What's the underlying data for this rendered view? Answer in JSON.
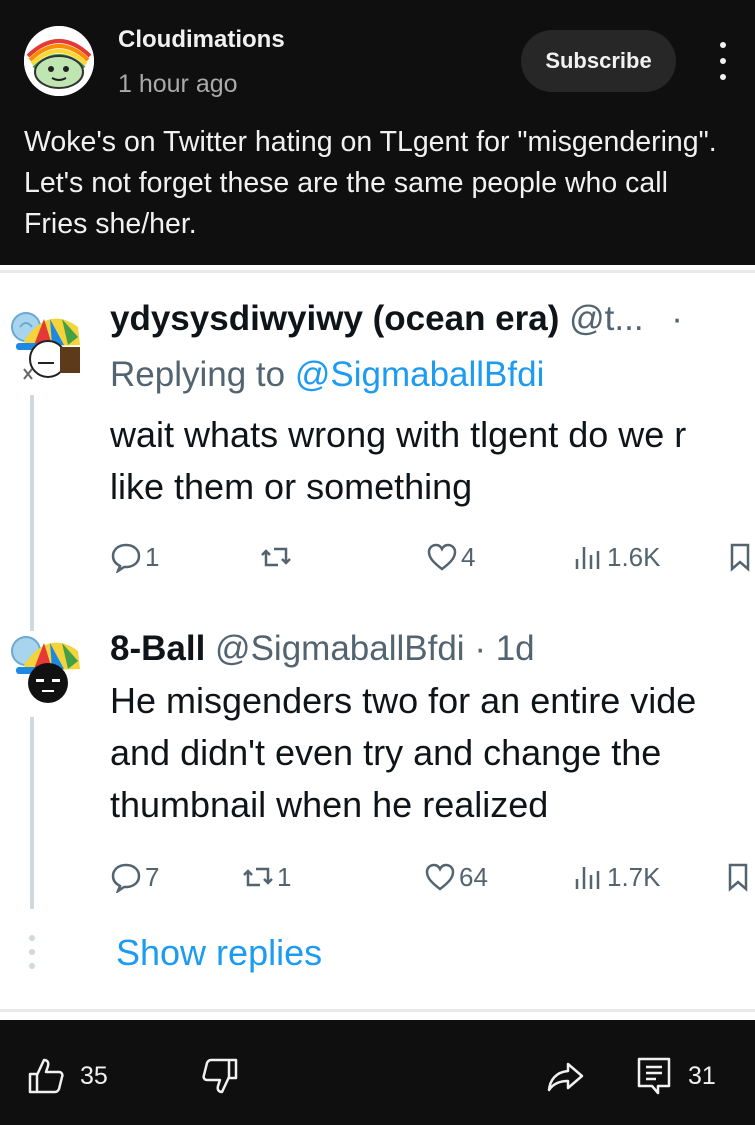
{
  "post": {
    "channel_name": "Cloudimations",
    "time": "1 hour ago",
    "subscribe_label": "Subscribe",
    "text": "Woke's on Twitter hating on TLgent for \"misgendering\". Let's not forget these are the same people who call Fries she/her."
  },
  "tweets": [
    {
      "display_name": "ydysysdiwyiwy (ocean era)",
      "handle": "@t...",
      "meta": "·",
      "replying_prefix": "Replying to ",
      "replying_to": "@SigmaballBfdi",
      "body_lines": [
        "wait whats wrong with tlgent do we r",
        "like them or something"
      ],
      "replies": "1",
      "retweets": "",
      "likes": "4",
      "views": "1.6K"
    },
    {
      "display_name": "8-Ball",
      "handle": "@SigmaballBfdi",
      "meta": "· 1d",
      "body_lines": [
        "He misgenders two for an entire vide",
        "and didn't even try and change the",
        "thumbnail when he realized"
      ],
      "replies": "7",
      "retweets": "1",
      "likes": "64",
      "views": "1.7K"
    }
  ],
  "show_replies": "Show replies",
  "action_bar": {
    "likes": "35",
    "comments": "31"
  },
  "icons": {
    "more": "more-vert-icon",
    "reply": "reply-bubble-icon",
    "retweet": "retweet-icon",
    "like": "heart-icon",
    "views": "views-bars-icon",
    "bookmark": "bookmark-icon",
    "thumbs_up": "thumbs-up-icon",
    "thumbs_down": "thumbs-down-icon",
    "share": "share-arrow-icon",
    "comment": "comment-icon"
  },
  "colors": {
    "background": "#0f0f0f",
    "subscribe_bg": "#272727",
    "twitter_blue": "#1d9bf0",
    "twitter_gray": "#536471"
  }
}
